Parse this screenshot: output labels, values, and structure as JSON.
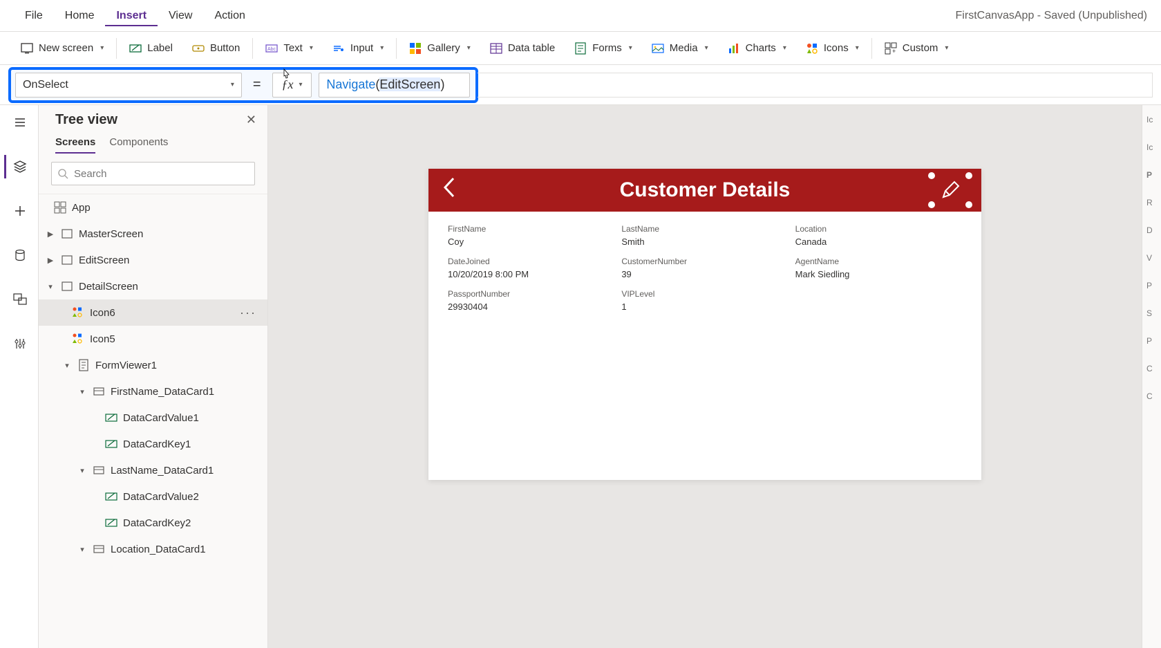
{
  "app_title": "FirstCanvasApp - Saved (Unpublished)",
  "menu": {
    "file": "File",
    "home": "Home",
    "insert": "Insert",
    "view": "View",
    "action": "Action"
  },
  "ribbon": {
    "new_screen": "New screen",
    "label": "Label",
    "button": "Button",
    "text": "Text",
    "input": "Input",
    "gallery": "Gallery",
    "data_table": "Data table",
    "forms": "Forms",
    "media": "Media",
    "charts": "Charts",
    "icons": "Icons",
    "custom": "Custom"
  },
  "formula": {
    "prop": "OnSelect",
    "fx": "fx",
    "expr": "Navigate(EditScreen)"
  },
  "tree": {
    "title": "Tree view",
    "tab_screens": "Screens",
    "tab_components": "Components",
    "search_ph": "Search",
    "app": "App",
    "items": {
      "master": "MasterScreen",
      "edit": "EditScreen",
      "detail": "DetailScreen",
      "icon6": "Icon6",
      "icon5": "Icon5",
      "formviewer": "FormViewer1",
      "fn_card": "FirstName_DataCard1",
      "dcv1": "DataCardValue1",
      "dck1": "DataCardKey1",
      "ln_card": "LastName_DataCard1",
      "dcv2": "DataCardValue2",
      "dck2": "DataCardKey2",
      "loc_card": "Location_DataCard1"
    }
  },
  "screen": {
    "title": "Customer Details",
    "fields": {
      "first_name_l": "FirstName",
      "first_name_v": "Coy",
      "last_name_l": "LastName",
      "last_name_v": "Smith",
      "location_l": "Location",
      "location_v": "Canada",
      "date_joined_l": "DateJoined",
      "date_joined_v": "10/20/2019 8:00 PM",
      "cust_num_l": "CustomerNumber",
      "cust_num_v": "39",
      "agent_l": "AgentName",
      "agent_v": "Mark Siedling",
      "passport_l": "PassportNumber",
      "passport_v": "29930404",
      "vip_l": "VIPLevel",
      "vip_v": "1"
    }
  },
  "right_hints": [
    "Ic",
    "Ic",
    "P",
    "R",
    "D",
    "V",
    "P",
    "S",
    "P",
    "C",
    "C"
  ]
}
